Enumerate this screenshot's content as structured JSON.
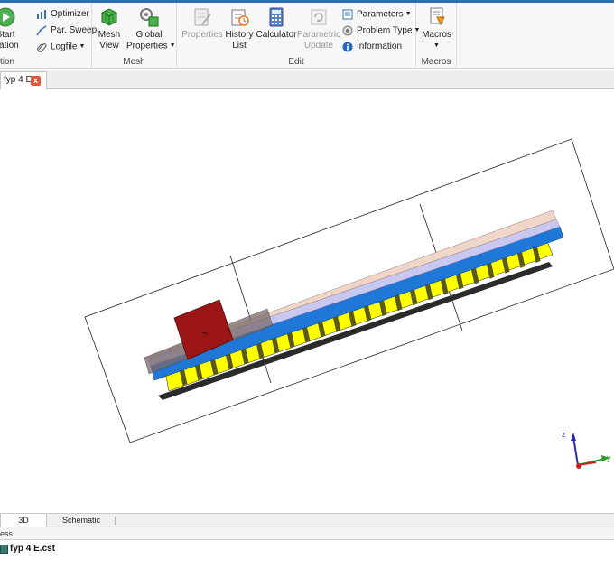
{
  "ribbon": {
    "simulation": {
      "start_label_line1": "Start",
      "start_label_line2": "ulation",
      "group_label": "tion",
      "optimizer": "Optimizer",
      "par_sweep": "Par. Sweep",
      "logfile": "Logfile"
    },
    "mesh": {
      "mesh_view_line1": "Mesh",
      "mesh_view_line2": "View",
      "global_line1": "Global",
      "global_line2": "Properties",
      "group_label": "Mesh"
    },
    "edit": {
      "properties": "Properties",
      "history_line1": "History",
      "history_line2": "List",
      "calculator": "Calculator",
      "param_update_line1": "Parametric",
      "param_update_line2": "Update",
      "parameters": "Parameters",
      "problem_type": "Problem Type",
      "information": "Information",
      "group_label": "Edit"
    },
    "macros": {
      "macros_label": "Macros",
      "group_label": "Macros"
    }
  },
  "doc_tab": {
    "label": "fyp 4 E",
    "close": "x"
  },
  "axis": {
    "z": "z",
    "y": "y"
  },
  "view_tabs": {
    "tab_3d": "3D",
    "tab_schematic": "Schematic"
  },
  "bottom_panel": {
    "header": "ess",
    "file": "fyp 4 E.cst"
  },
  "colors": {
    "accent": "#2a6fb6",
    "substrate_yellow": "#ffff00",
    "patch_blue": "#1f78d8",
    "layer_lavender": "#c8c8f0",
    "layer_peach": "#f0d6c8",
    "block_red": "#9b1515"
  }
}
